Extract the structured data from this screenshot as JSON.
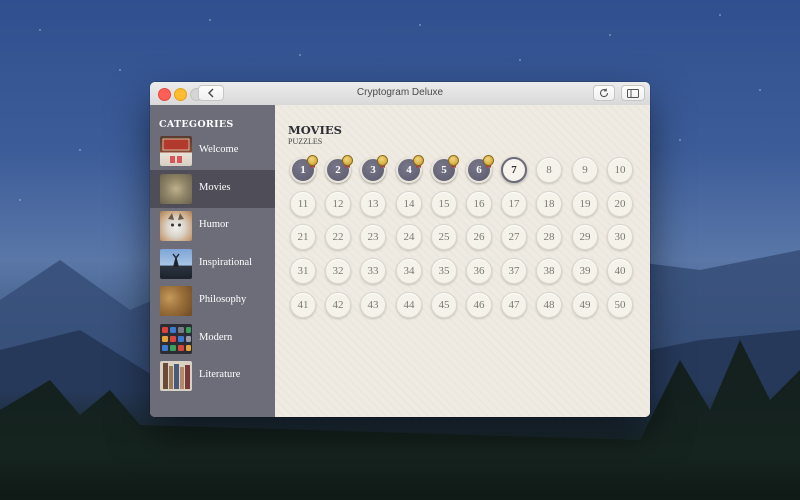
{
  "window": {
    "title": "Cryptogram Deluxe"
  },
  "sidebar": {
    "heading": "CATEGORIES",
    "items": [
      {
        "label": "Welcome",
        "thumb": "welcome-thumb"
      },
      {
        "label": "Movies",
        "thumb": "movies-thumb",
        "selected": true
      },
      {
        "label": "Humor",
        "thumb": "humor-thumb"
      },
      {
        "label": "Inspirational",
        "thumb": "inspirational-thumb"
      },
      {
        "label": "Philosophy",
        "thumb": "philosophy-thumb"
      },
      {
        "label": "Modern",
        "thumb": "modern-thumb"
      },
      {
        "label": "Literature",
        "thumb": "literature-thumb"
      }
    ]
  },
  "main": {
    "title": "MOVIES",
    "subtitle": "PUZZLES",
    "completed": [
      1,
      2,
      3,
      4,
      5,
      6
    ],
    "current": 7,
    "puzzles": [
      1,
      2,
      3,
      4,
      5,
      6,
      7,
      8,
      9,
      10,
      11,
      12,
      13,
      14,
      15,
      16,
      17,
      18,
      19,
      20,
      21,
      22,
      23,
      24,
      25,
      26,
      27,
      28,
      29,
      30,
      31,
      32,
      33,
      34,
      35,
      36,
      37,
      38,
      39,
      40,
      41,
      42,
      43,
      44,
      45,
      46,
      47,
      48,
      49,
      50
    ]
  },
  "colors": {
    "sidebar": "#6d6c79",
    "sidebar_selected": "#4f4e58",
    "completed_puzzle": "#5f5f71",
    "content_bg": "#efebe2"
  },
  "icons": {
    "back": "chevron-left-icon",
    "refresh": "refresh-icon",
    "panel": "sidebar-panel-icon"
  }
}
